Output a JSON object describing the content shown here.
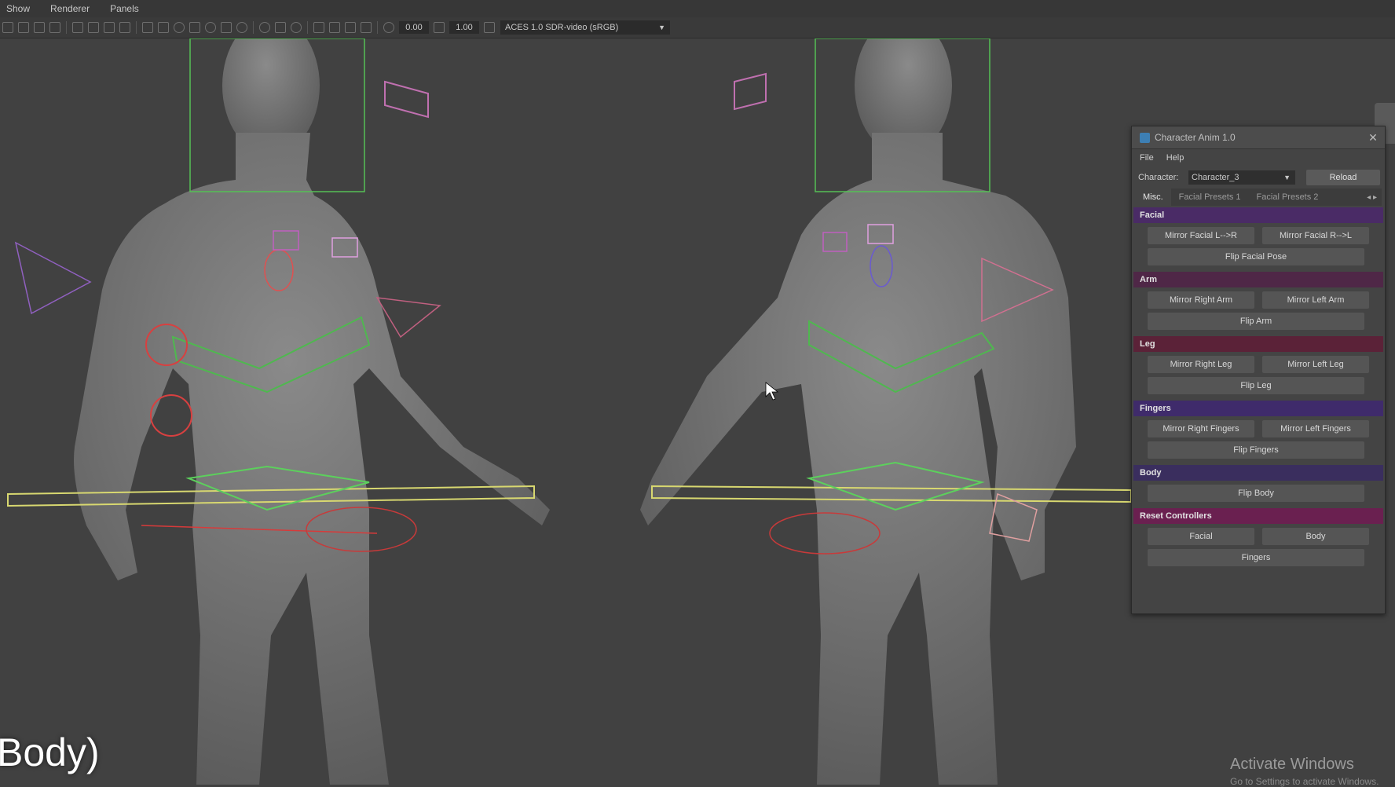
{
  "menubar": {
    "items": [
      "Show",
      "Renderer",
      "Panels"
    ]
  },
  "toolbar": {
    "field1": "0.00",
    "field2": "1.00",
    "colorspace": "ACES 1.0 SDR-video (sRGB)"
  },
  "viewport": {
    "caption": "Body)",
    "watermark": "Activate Windows",
    "watermark_sub": "Go to Settings to activate Windows."
  },
  "panel": {
    "title": "Character Anim 1.0",
    "menu": [
      "File",
      "Help"
    ],
    "character_label": "Character:",
    "character_value": "Character_3",
    "reload": "Reload",
    "tabs": [
      "Misc.",
      "Facial Presets 1",
      "Facial Presets 2"
    ],
    "sections": {
      "facial": {
        "title": "Facial",
        "mirror_l_r": "Mirror Facial L-->R",
        "mirror_r_l": "Mirror Facial R-->L",
        "flip": "Flip Facial Pose"
      },
      "arm": {
        "title": "Arm",
        "mirror_right": "Mirror Right Arm",
        "mirror_left": "Mirror Left Arm",
        "flip": "Flip Arm"
      },
      "leg": {
        "title": "Leg",
        "mirror_right": "Mirror Right Leg",
        "mirror_left": "Mirror Left Leg",
        "flip": "Flip Leg"
      },
      "fingers": {
        "title": "Fingers",
        "mirror_right": "Mirror Right Fingers",
        "mirror_left": "Mirror Left Fingers",
        "flip": "Flip Fingers"
      },
      "body": {
        "title": "Body",
        "flip": "Flip Body"
      },
      "reset": {
        "title": "Reset Controllers",
        "facial": "Facial",
        "body": "Body",
        "fingers": "Fingers"
      }
    }
  },
  "colors": {
    "facial": "#4a2b66",
    "arm": "#4f2747",
    "leg": "#5b2238",
    "fingers": "#3f2b6b",
    "body": "#3a2e5e",
    "reset": "#6a2050"
  }
}
